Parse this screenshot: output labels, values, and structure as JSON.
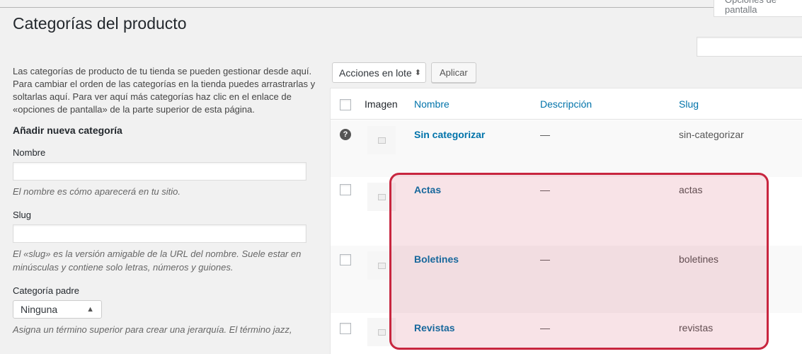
{
  "header": {
    "title": "Categorías del producto",
    "screen_options": "Opciones de pantalla"
  },
  "sidebar": {
    "intro": "Las categorías de producto de tu tienda se pueden gestionar desde aquí. Para cambiar el orden de las categorías en la tienda puedes arrastrarlas y soltarlas aquí. Para ver aquí más categorías haz clic en el enlace de «opciones de pantalla» de la parte superior de esta página.",
    "form_title": "Añadir nueva categoría",
    "name_label": "Nombre",
    "name_hint": "El nombre es cómo aparecerá en tu sitio.",
    "slug_label": "Slug",
    "slug_hint": "El «slug» es la versión amigable de la URL del nombre. Suele estar en minúsculas y contiene solo letras, números y guiones.",
    "parent_label": "Categoría padre",
    "parent_value": "Ninguna",
    "parent_hint": "Asigna un término superior para crear una jerarquía. El término jazz,"
  },
  "toolbar": {
    "bulk_actions": "Acciones en lote",
    "apply": "Aplicar"
  },
  "table": {
    "columns": {
      "image": "Imagen",
      "name": "Nombre",
      "description": "Descripción",
      "slug": "Slug"
    },
    "rows": [
      {
        "name": "Sin categorizar",
        "description": "—",
        "slug": "sin-categorizar"
      },
      {
        "name": "Actas",
        "description": "—",
        "slug": "actas"
      },
      {
        "name": "Boletines",
        "description": "—",
        "slug": "boletines"
      },
      {
        "name": "Revistas",
        "description": "—",
        "slug": "revistas"
      }
    ]
  },
  "colors": {
    "link": "#0073aa",
    "highlight_border": "#c8263f"
  }
}
